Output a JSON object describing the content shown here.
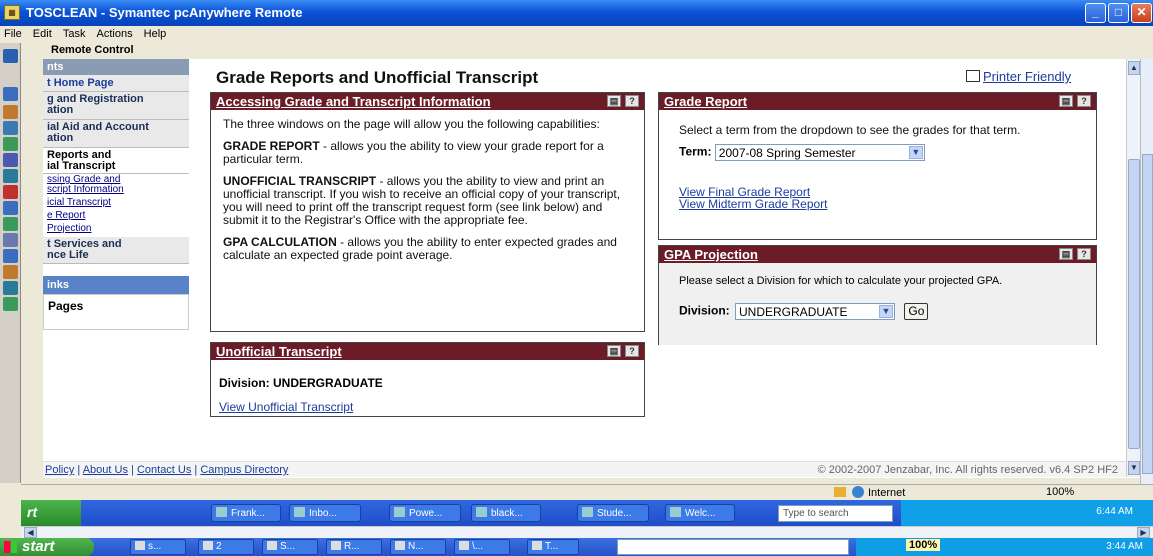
{
  "window": {
    "title": "TOSCLEAN - Symantec pcAnywhere Remote",
    "app_icon": "pcanywhere-icon",
    "menu": [
      "File",
      "Edit",
      "Task",
      "Actions",
      "Help"
    ],
    "remote_control_label": "Remote Control"
  },
  "sidebar": {
    "sections": [
      {
        "label": "nts",
        "type": "header"
      },
      {
        "label": "t Home Page",
        "type": "section"
      },
      {
        "label": "g and Registration\nation",
        "type": "section"
      },
      {
        "label": "ial Aid and Account\nation",
        "type": "section"
      },
      {
        "label": "Reports and\nial Transcript",
        "type": "section"
      }
    ],
    "links": [
      "ssing Grade and\nscript Information",
      "icial Transcript",
      "e Report",
      "Projection"
    ],
    "services": "t Services and\nnce Life",
    "links_header": "inks",
    "pages": "Pages"
  },
  "page": {
    "title": "Grade Reports and Unofficial Transcript",
    "printer_friendly": "Printer Friendly"
  },
  "accessing_panel": {
    "header": "Accessing Grade and Transcript Information",
    "intro": "The three windows on the page will allow you the following capabilities:",
    "grade_label": "GRADE REPORT",
    "grade_text": " - allows you the ability to view your grade report for a particular term.",
    "transcript_label": "UNOFFICIAL TRANSCRIPT",
    "transcript_text": " - allows you the ability to view and print an unofficial transcript.  If you wish to receive an official copy of your transcript, you will need to print off the transcript request form (see link below) and submit it to the Registrar's Office with the appropriate fee.",
    "gpa_label": "GPA CALCULATION",
    "gpa_text": " - allows you the ability to enter expected grades and calculate an expected grade point average."
  },
  "grade_panel": {
    "header": "Grade Report",
    "instructions": "Select a term from the dropdown to see the grades for that term.",
    "term_label": "Term:",
    "term_value": "2007-08 Spring Semester",
    "link_final": "View Final Grade Report",
    "link_midterm": "View Midterm Grade Report"
  },
  "gpa_panel": {
    "header": "GPA Projection",
    "instructions": "Please select a Division for which to calculate your projected GPA.",
    "division_label": "Division:",
    "division_value": "UNDERGRADUATE",
    "go_label": "Go"
  },
  "transcript_panel": {
    "header": "Unofficial Transcript",
    "division_text": "Division: UNDERGRADUATE",
    "link": "View Unofficial Transcript"
  },
  "footer": {
    "links": [
      "Policy",
      "About Us",
      "Contact Us",
      "Campus Directory"
    ],
    "copyright": "© 2002-2007 Jenzabar, Inc. All rights reserved. v6.4 SP2 HF2"
  },
  "ie_status": {
    "zone": "Internet",
    "zoom": "100%"
  },
  "remote_taskbar": {
    "start": "rt",
    "tasks": [
      "Frank...",
      "Inbo...",
      "Powe...",
      "black...",
      "Stude...",
      "Welc..."
    ],
    "search_placeholder": "Type to search",
    "clock": "6:44 AM"
  },
  "taskbar": {
    "start": "start",
    "items": [
      "s...",
      "2",
      "S...",
      "R...",
      "N...",
      "\\...",
      "T..."
    ],
    "battery": "100%",
    "clock": "3:44 AM"
  }
}
